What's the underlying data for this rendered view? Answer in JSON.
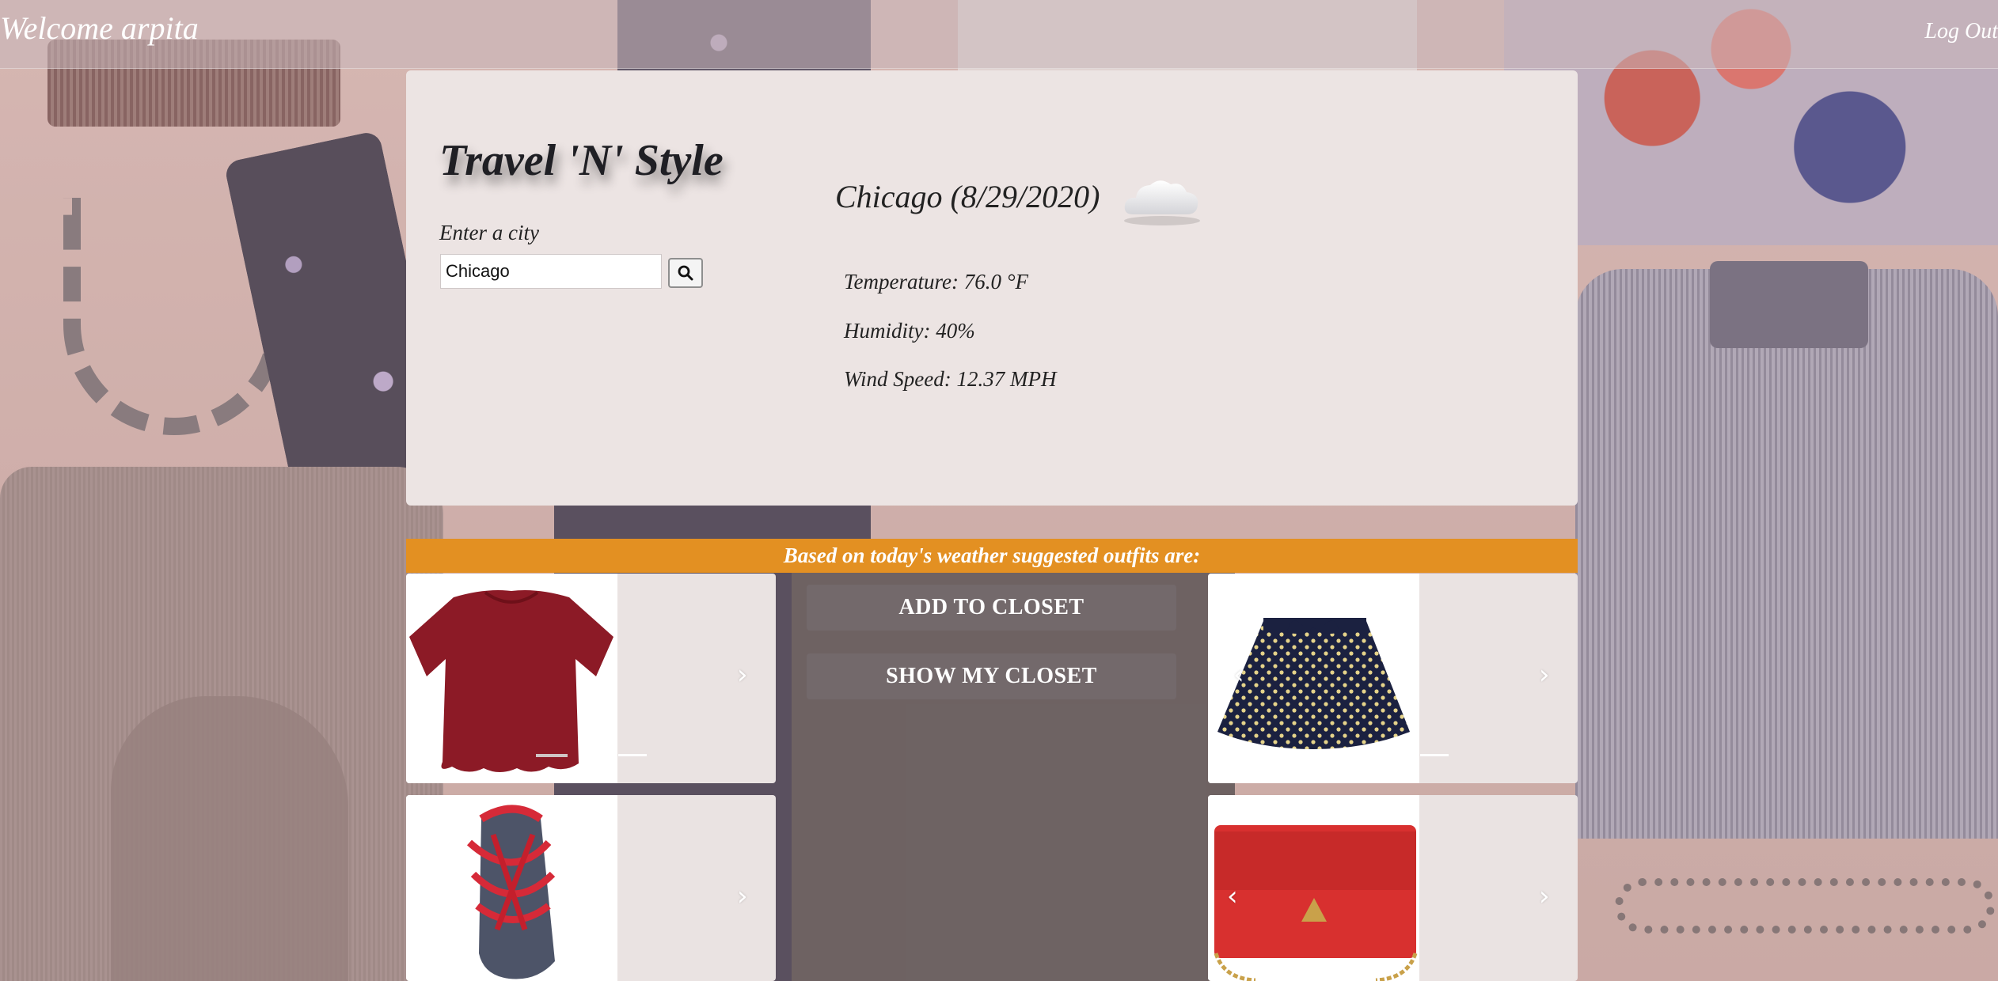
{
  "header": {
    "welcome": "Welcome arpita",
    "logout": "Log Out"
  },
  "app": {
    "title": "Travel 'N' Style"
  },
  "search": {
    "label": "Enter a city",
    "value": "Chicago",
    "button_icon": "search-icon"
  },
  "weather": {
    "heading": "Chicago (8/29/2020)",
    "condition_icon": "cloud-icon",
    "temperature": "Temperature: 76.0 °F",
    "humidity": "Humidity: 40%",
    "wind": "Wind Speed: 12.37 MPH"
  },
  "outfits": {
    "banner": "Based on today's weather suggested outfits are:",
    "add_to_closet": "ADD TO CLOSET",
    "show_closet": "SHOW MY CLOSET",
    "cards": [
      {
        "item": "red-blouse",
        "icon": "chevron-right-icon"
      },
      {
        "item": "polka-dot-skirt",
        "icon": "chevron-right-icon"
      },
      {
        "item": "red-sandal",
        "icon": "chevron-right-icon"
      },
      {
        "item": "red-handbag",
        "icon": "chevron-right-icon"
      }
    ]
  },
  "colors": {
    "banner": "#e39022",
    "panel": "#ece4e3",
    "accent_text": "#ffffff"
  }
}
